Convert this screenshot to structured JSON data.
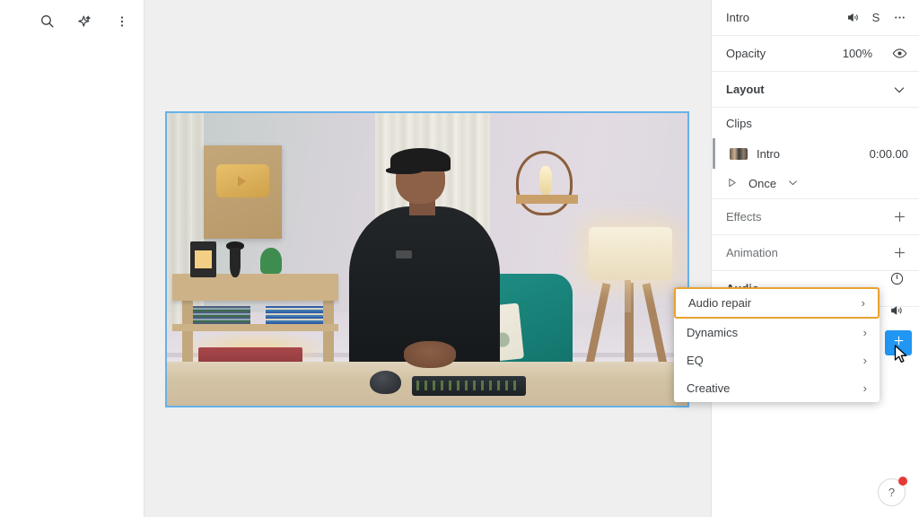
{
  "left_toolbar": {
    "buttons": [
      {
        "name": "search-icon",
        "label": "Search"
      },
      {
        "name": "magic-sparkle-icon",
        "label": "Enhance"
      },
      {
        "name": "more-vertical-icon",
        "label": "More options"
      }
    ]
  },
  "canvas": {
    "selection_color": "#66b2e8",
    "background_color": "#efefef",
    "clip_label": "Intro"
  },
  "right_panel": {
    "header": {
      "title": "Intro",
      "mute_icon": "speaker-icon",
      "solo_label": "S",
      "more_icon": "more-horizontal-icon"
    },
    "opacity": {
      "label": "Opacity",
      "value": "100%",
      "visibility_icon": "eye-icon"
    },
    "layout": {
      "label": "Layout",
      "chevron": "chevron-down-icon"
    },
    "clips": {
      "title": "Clips",
      "item": {
        "name": "Intro",
        "time": "0:00.00"
      },
      "loop": {
        "play_icon": "play-icon",
        "label": "Once",
        "chevron": "chevron-down-icon"
      }
    },
    "effects": {
      "label": "Effects",
      "add_icon": "plus-icon"
    },
    "animation": {
      "label": "Animation",
      "add_icon": "plus-icon"
    },
    "audio": {
      "label": "Audio",
      "clock_icon": "clock-icon",
      "speaker_icon": "speaker-icon",
      "tool_button_icon": "audio-effect-icon",
      "tool_button_color": "#2196f3"
    }
  },
  "context_menu": {
    "highlight_color": "#e9a22e",
    "items": [
      {
        "label": "Audio repair",
        "arrow": "›",
        "active": true
      },
      {
        "label": "Dynamics",
        "arrow": "›",
        "active": false
      },
      {
        "label": "EQ",
        "arrow": "›",
        "active": false
      },
      {
        "label": "Creative",
        "arrow": "›",
        "active": false
      }
    ]
  },
  "help": {
    "label": "?",
    "badge_color": "#e53935"
  }
}
